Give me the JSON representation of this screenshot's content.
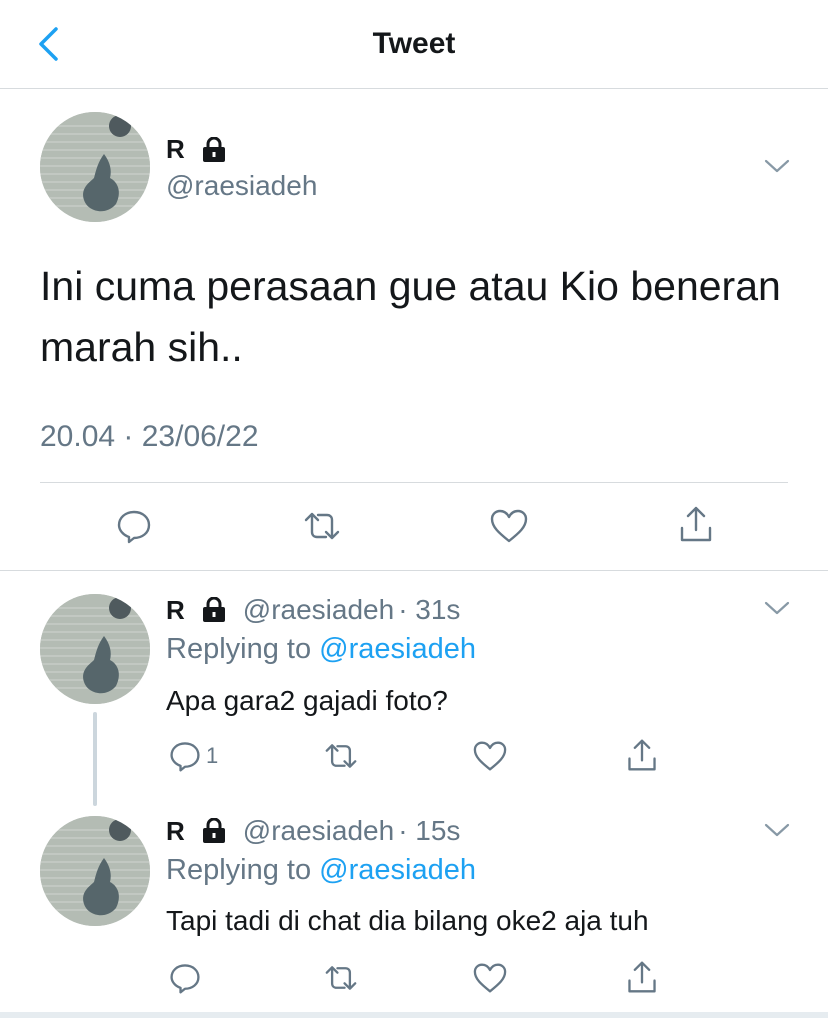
{
  "header": {
    "title": "Tweet",
    "back_icon": "chevron-left-icon"
  },
  "main_tweet": {
    "name": "R",
    "handle": "@raesiadeh",
    "text": "Ini cuma perasaan gue atau Kio beneran marah sih..",
    "timestamp": "20.04 · 23/06/22"
  },
  "replies": [
    {
      "name": "R",
      "handle": "@raesiadeh",
      "age": "· 31s",
      "replying_prefix": "Replying to ",
      "replying_to": "@raesiadeh",
      "text": "Apa gara2 gajadi foto?",
      "reply_count": "1"
    },
    {
      "name": "R",
      "handle": "@raesiadeh",
      "age": "· 15s",
      "replying_prefix": "Replying to ",
      "replying_to": "@raesiadeh",
      "text": "Tapi tadi di chat dia bilang oke2 aja tuh",
      "reply_count": ""
    }
  ],
  "colors": {
    "accent": "#1da1f2",
    "secondary_text": "#657786",
    "divider": "#d7dbde"
  }
}
